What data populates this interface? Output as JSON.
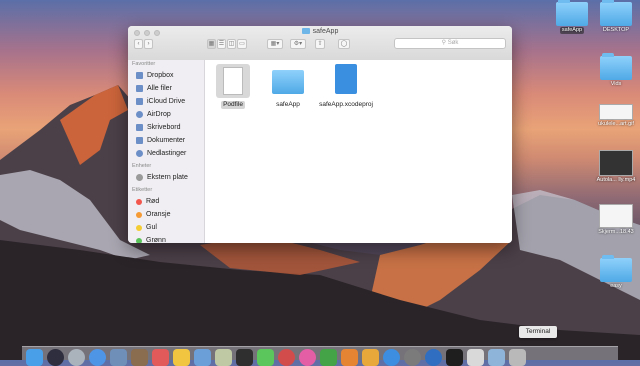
{
  "window": {
    "title": "safeApp"
  },
  "toolbar": {
    "search_placeholder": "Søk"
  },
  "sidebar": {
    "favorites_header": "Favoritter",
    "favorites": [
      {
        "label": "Dropbox",
        "icon": "dropbox-icon"
      },
      {
        "label": "Alle filer",
        "icon": "all-files-icon"
      },
      {
        "label": "iCloud Drive",
        "icon": "cloud-icon"
      },
      {
        "label": "AirDrop",
        "icon": "airdrop-icon"
      },
      {
        "label": "Skrivebord",
        "icon": "desktop-icon"
      },
      {
        "label": "Dokumenter",
        "icon": "documents-icon"
      },
      {
        "label": "Nedlastinger",
        "icon": "downloads-icon"
      }
    ],
    "devices_header": "Enheter",
    "devices": [
      {
        "label": "Ekstern plate",
        "icon": "disk-icon"
      }
    ],
    "tags_header": "Etiketter",
    "tags": [
      {
        "label": "Rød",
        "color": "#f2564c"
      },
      {
        "label": "Oransje",
        "color": "#f59a34"
      },
      {
        "label": "Gul",
        "color": "#f3cd33"
      },
      {
        "label": "Grønn",
        "color": "#5ac35a"
      }
    ]
  },
  "files": [
    {
      "label": "Podfile",
      "icon": "document-icon",
      "selected": true
    },
    {
      "label": "safeApp",
      "icon": "folder-icon"
    },
    {
      "label": "safeApp.xcodeproj",
      "icon": "xcode-project-icon"
    }
  ],
  "desktop": [
    {
      "label": "safeApp",
      "icon": "folder-icon"
    },
    {
      "label": "DESKTOP",
      "icon": "folder-icon"
    },
    {
      "label": "Vids",
      "icon": "folder-icon"
    },
    {
      "label": "ukulele...art.gif",
      "icon": "image-thumbnail-icon"
    },
    {
      "label": "Autola... lly.mp4",
      "icon": "video-thumbnail-icon"
    },
    {
      "label": "Skjerm...18.43",
      "icon": "screenshot-thumbnail-icon"
    },
    {
      "label": "easy",
      "icon": "folder-icon"
    }
  ],
  "dock": {
    "tooltip": "Terminal"
  }
}
